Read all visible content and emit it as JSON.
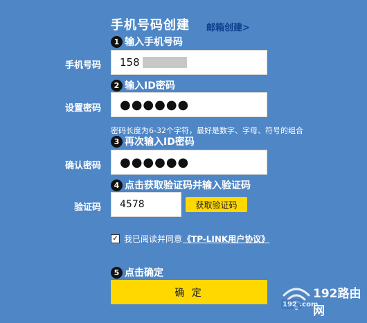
{
  "header": {
    "title": "手机号码创建",
    "alt_link": "邮箱创建>"
  },
  "steps": [
    {
      "num": "1",
      "text": "输入手机号码"
    },
    {
      "num": "2",
      "text": "输入ID密码"
    },
    {
      "num": "3",
      "text": "再次输入ID密码"
    },
    {
      "num": "4",
      "text": "点击获取验证码并输入验证码"
    },
    {
      "num": "5",
      "text": "点击确定"
    }
  ],
  "form": {
    "phone": {
      "label": "手机号码",
      "value": "158"
    },
    "password": {
      "label": "设置密码",
      "value": "●●●●●●"
    },
    "password_hint": "密码长度为6-32个字符，最好是数字、字母、符号的组合",
    "confirm": {
      "label": "确认密码",
      "value": "●●●●●●"
    },
    "code": {
      "label": "验证码",
      "value": "4578",
      "button": "获取验证码"
    },
    "agree": {
      "checked_mark": "✓",
      "text": "我已阅读并同意",
      "link": "《TP-LINK用户协议》"
    },
    "submit": "确 定"
  },
  "watermark": {
    "text": "192路由网",
    "sub": "192 .com"
  },
  "colors": {
    "background": "#4f86c6",
    "accent": "#ffd800",
    "link": "#0d3f8c"
  }
}
